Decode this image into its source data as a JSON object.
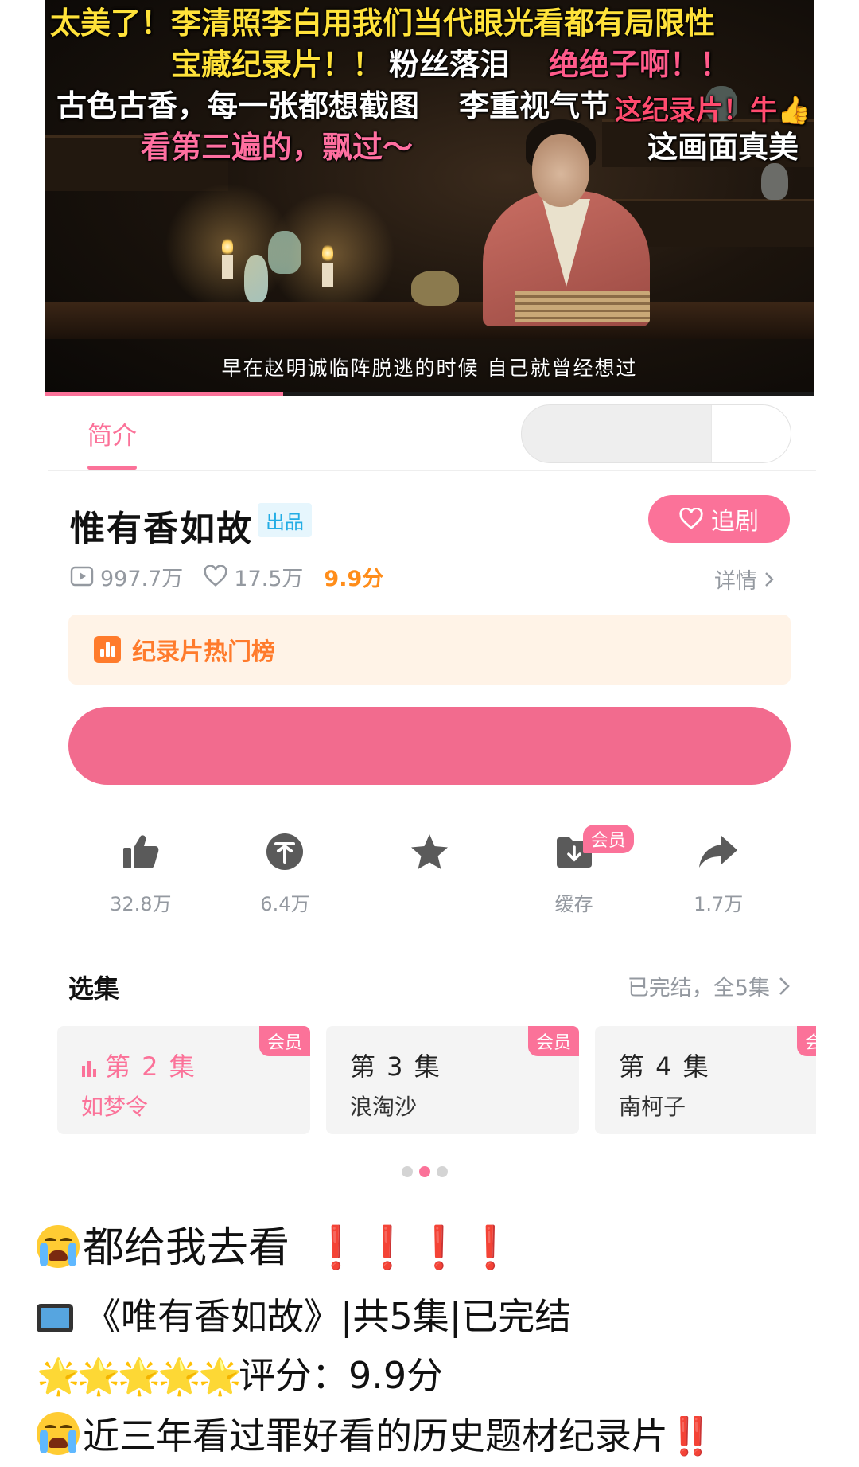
{
  "video": {
    "danmaku": [
      {
        "text": "太美了！李清照李白用我们当代眼光看都有局限性",
        "color": "#ffe23a"
      },
      {
        "text": "宝藏纪录片！！",
        "color": "#ffe23a"
      },
      {
        "text": "粉丝落泪",
        "color": "#ffffff"
      },
      {
        "text": "绝绝子啊！！",
        "color": "#ff5a8a"
      },
      {
        "text": "古色古香，每一张都想截图",
        "color": "#ffffff"
      },
      {
        "text": "李重视气节",
        "color": "#ffffff"
      },
      {
        "text": "这纪录片！牛👍",
        "color": "#ff4b6e"
      },
      {
        "text": "看第三遍的，飘过～",
        "color": "#ff6fa0"
      },
      {
        "text": "这画面真美",
        "color": "#ffffff"
      }
    ],
    "subtitle": "早在赵明诚临阵脱逃的时候 自己就曾经想过",
    "progress_fraction": 0.31
  },
  "tabs": {
    "intro": "简介"
  },
  "info": {
    "title": "惟有香如故",
    "badge": "出品",
    "follow_label": "追剧",
    "views": "997.7万",
    "favs": "17.5万",
    "score": "9.9分",
    "detail_label": "详情"
  },
  "rank": {
    "label": "纪录片热门榜"
  },
  "actions": {
    "like_count": "32.8万",
    "coin_count": "6.4万",
    "fav_count": "",
    "cache_label": "缓存",
    "cache_tag": "会员",
    "share_count": "1.7万"
  },
  "episodes": {
    "header": "选集",
    "status": "已完结，全5集",
    "items": [
      {
        "num": "第 2 集",
        "name": "如梦令",
        "tag": "会员"
      },
      {
        "num": "第 3 集",
        "name": "浪淘沙",
        "tag": "会员"
      },
      {
        "num": "第 4 集",
        "name": "南柯子",
        "tag": "会员"
      }
    ]
  },
  "post": {
    "line1": "都给我去看",
    "line1_marks": "❗❗❗❗",
    "line2": "《唯有香如故》|共5集|已完结",
    "line3_stars": "🌟🌟🌟🌟🌟",
    "line3": "评分：9.9分",
    "line4": "近三年看过罪好看的历史题材纪录片",
    "line4_marks": "‼️"
  },
  "colors": {
    "accent": "#fb7299",
    "rank": "#ff7b2c",
    "score": "#ff8d1a"
  }
}
